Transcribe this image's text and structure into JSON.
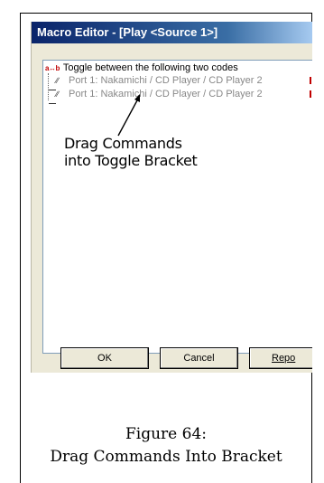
{
  "window": {
    "title": "Macro Editor - [Play <Source 1>]"
  },
  "tree": {
    "toggle_icon_text": "a↔b",
    "toggle_label": "Toggle between the following two codes",
    "commands": [
      {
        "label": "Port 1: Nakamichi / CD Player / CD Player 2"
      },
      {
        "label": "Port 1: Nakamichi / CD Player / CD Player 2"
      }
    ]
  },
  "callout": {
    "line1": "Drag Commands",
    "line2": "into Toggle Bracket"
  },
  "buttons": {
    "ok": "OK",
    "cancel": "Cancel",
    "report": "Repo"
  },
  "caption": {
    "line1": "Figure 64:",
    "line2": "Drag Commands Into Bracket"
  }
}
